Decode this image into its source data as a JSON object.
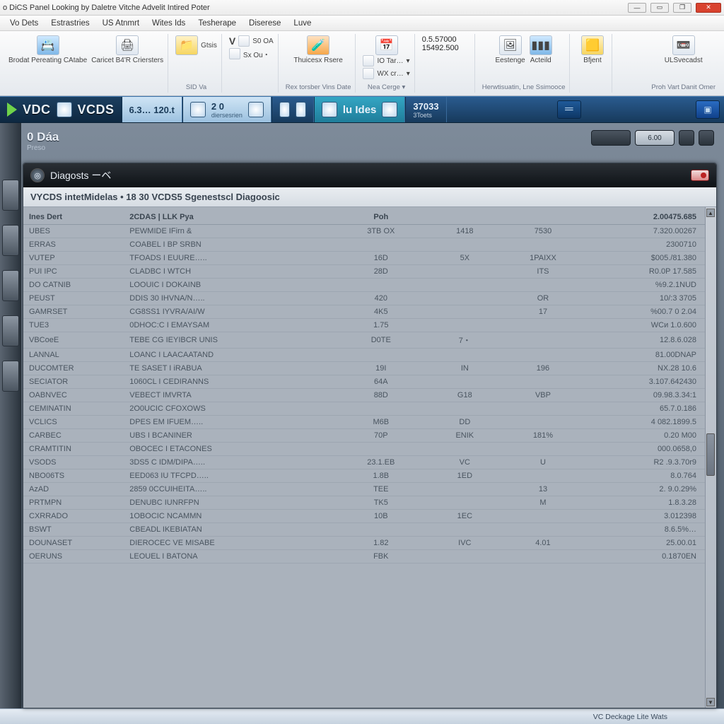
{
  "window": {
    "title": "o DiCS Panel Looking by Daletre Vitche Advelit Intired Poter"
  },
  "menu": {
    "items": [
      "Vo Dets",
      "Estrastries",
      "US Atnmrt",
      "Wites Ids",
      "Tesherape",
      "Diserese",
      "Luve"
    ]
  },
  "ribbon": {
    "g1": {
      "btn1": "Brodat Pereating CAtabe",
      "btn2": "Caricet B4'R Criersters"
    },
    "g2": {
      "top": "Gtsis",
      "label": "SID Va"
    },
    "g3": {
      "row1": "S0 OA",
      "row2": "Sx Ou・",
      "label": "V"
    },
    "g4": {
      "label": "Thuicesx Rsere",
      "footer": "Rex torsber Vins Date"
    },
    "g5": {
      "row1": "IO Tar…",
      "row2": "WX cr…",
      "footer": "Nea Cerge ▾",
      "drop": "▾"
    },
    "g6": {
      "num1": "0.5.57000",
      "num2": "15492.500"
    },
    "g7": {
      "btn1": "Eestenge",
      "btn2": "Acteild",
      "footer": "Herwtisuatin, Lne Ssimooce"
    },
    "g8": {
      "btn": "Bfjent"
    },
    "g9": {
      "btn": "ULSvecadst",
      "footer": "Proh Vart Danit Omer"
    }
  },
  "appbar": {
    "brand1": "VDC",
    "brand2": "VCDS",
    "seg1_val": "6.3… 120.t",
    "seg2_top": "2 0",
    "seg2_sub": "diersesrien",
    "seg3": "lu Ides",
    "seg4_top": "37033",
    "seg4_sub": "3Toets"
  },
  "doc": {
    "title": "0 Dáa",
    "sub": "Preso",
    "btn_right": "6.00"
  },
  "panel": {
    "header": "Diagosts ーベ",
    "title": "VYCDS intetMidelas • 18 30 VCDS5 Sgenestscl Diagoosic",
    "headers": [
      "Ines Dert",
      "2CDAS | LLK Pya",
      "Poh",
      "",
      "",
      "2.00475.685"
    ],
    "rows": [
      {
        "c1": "UBES",
        "c2": "PEWMIDE IFirn &",
        "c3": "3TB OX",
        "c4": "1418",
        "c5": "7530",
        "c6": "7.320.00267"
      },
      {
        "c1": "ERRAS",
        "c2": "COABEL I BP SRBN",
        "c3": "",
        "c4": "",
        "c5": "",
        "c6": "2300710"
      },
      {
        "c1": "VUTEP",
        "c2": "TFOADS I EUURE…..",
        "c3": "16D",
        "c4": "5X",
        "c5": "1PAIXX",
        "c6": "$005./81.380"
      },
      {
        "c1": "PUI IPC",
        "c2": "CLADBC I WTCH",
        "c3": "28D",
        "c4": "",
        "c5": "ITS",
        "c6": "R0.0P 17.585"
      },
      {
        "c1": "DO CATNIB",
        "c2": "LOOUIC I DOKAINB",
        "c3": "",
        "c4": "",
        "c5": "",
        "c6": "%9.2.1NUD"
      },
      {
        "c1": "PEUST",
        "c2": "DDIS 30 IHVNA/N…..",
        "c3": "420",
        "c4": "",
        "c5": "OR",
        "c6": "10/:3 3705"
      },
      {
        "c1": "GAMRSET",
        "c2": "CG8SS1 IYVRA/AI/W",
        "c3": "4K5",
        "c4": "",
        "c5": "17",
        "c6": "%00.7 0 2.04"
      },
      {
        "c1": "TUE3",
        "c2": "0DHOC:C I EMAYSAM",
        "c3": "1.75",
        "c4": "",
        "c5": "",
        "c6": "WCи 1.0.600"
      },
      {
        "c1": "VBCoeE",
        "c2": "TEBE CG IEYIBCR UNIS",
        "c3": "D0TE",
        "c4": "7・",
        "c5": "",
        "c6": "12.8.6.028"
      },
      {
        "c1": "LANNAL",
        "c2": "LOANC I LAACAATAND",
        "c3": "",
        "c4": "",
        "c5": "",
        "c6": "81.00DNAP"
      },
      {
        "c1": "DUCOMTER",
        "c2": "TE SASET I iRABUA",
        "c3": "19I",
        "c4": "IN",
        "c5": "196",
        "c6": "NX.28 10.6"
      },
      {
        "c1": "SECIATOR",
        "c2": "1060CL I CEDIRANNS",
        "c3": "64A",
        "c4": "",
        "c5": "",
        "c6": "3.107.642430"
      },
      {
        "c1": "OABNVEC",
        "c2": "VEBECT IMVRTA",
        "c3": "88D",
        "c4": "G18",
        "c5": "VBP",
        "c6": "09.98.3.34:1"
      },
      {
        "c1": "CEMINATIN",
        "c2": "2O0UCIC CFOXOWS",
        "c3": "",
        "c4": "",
        "c5": "",
        "c6": "65.7.0.186"
      },
      {
        "c1": "VCLICS",
        "c2": "DPES EM IFUEM…..",
        "c3": "M6B",
        "c4": "DD",
        "c5": "",
        "c6": "4 082.1899.5"
      },
      {
        "c1": "CARBEC",
        "c2": "UBS I BCANINER",
        "c3": "70P",
        "c4": "ENIK",
        "c5": "181%",
        "c6": "0.20 M00"
      },
      {
        "c1": "CRAMTITIN",
        "c2": "OBOCEC I ETACONES",
        "c3": "",
        "c4": "",
        "c5": "",
        "c6": "000.0658,0"
      },
      {
        "c1": "VSODS",
        "c2": "3DS5 C IDM/DIPA…..",
        "c3": "23.1.EB",
        "c4": "VC",
        "c5": "U",
        "c6": "R2 .9.3.70r9"
      },
      {
        "c1": "NBO06TS",
        "c2": "EED063 IU TFCPD…..",
        "c3": "1.8B",
        "c4": "1ED",
        "c5": "",
        "c6": "8.0.764"
      },
      {
        "c1": "AzAD",
        "c2": "2859 0CCUIHEITA…..",
        "c3": "TEE",
        "c4": "",
        "c5": "13",
        "c6": "2. 9.0.29%"
      },
      {
        "c1": "PRTMPN",
        "c2": "DENUBC IUNRFPN",
        "c3": "TK5",
        "c4": "",
        "c5": "M",
        "c6": "1.8.3.28"
      },
      {
        "c1": "CXRRADO",
        "c2": "1OBOCIC NCAMMN",
        "c3": "10B",
        "c4": "1EC",
        "c5": "",
        "c6": "3.012398"
      },
      {
        "c1": "BSWT",
        "c2": "CBEADL IKEBIATAN",
        "c3": "",
        "c4": "",
        "c5": "",
        "c6": "8.6.5%…"
      },
      {
        "c1": "DOUNASET",
        "c2": "DIEROCEC VE MISABE",
        "c3": "1.82",
        "c4": "IVC",
        "c5": "4.01",
        "c6": "25.00.01"
      },
      {
        "c1": "OERUNS",
        "c2": "LEOUEL I BATONA",
        "c3": "FBK",
        "c4": "",
        "c5": "",
        "c6": "0.1870EN"
      }
    ]
  },
  "status": {
    "text": "VC Deckage Lite Wats"
  }
}
